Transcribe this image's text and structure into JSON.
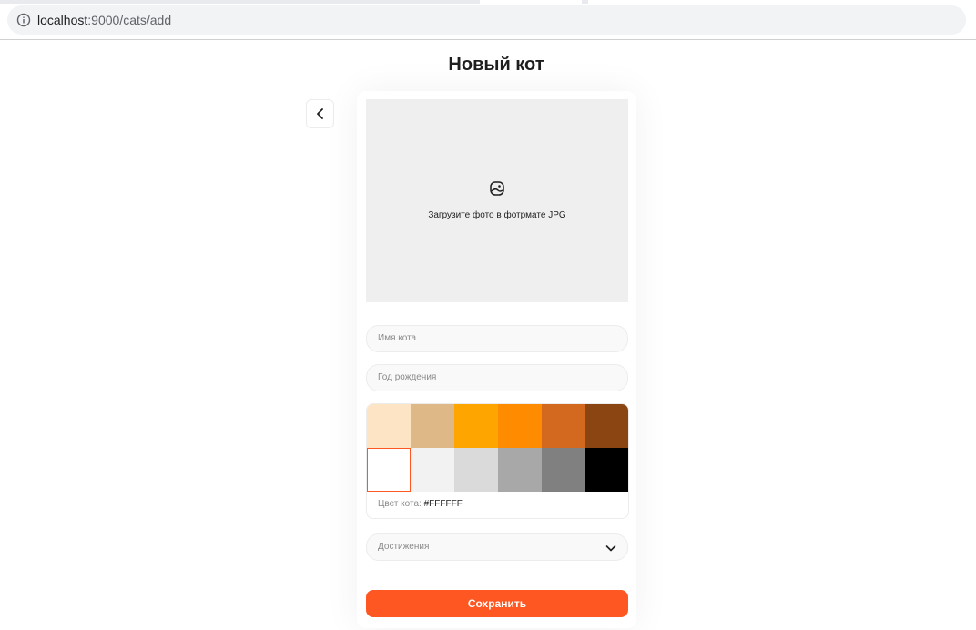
{
  "browser": {
    "url_host": "localhost",
    "url_path": ":9000/cats/add"
  },
  "page": {
    "title": "Новый кот"
  },
  "upload": {
    "text": "Загрузите фото в фотрмате JPG"
  },
  "form": {
    "name_placeholder": "Имя кота",
    "year_placeholder": "Год рождения",
    "color_label": "Цвет кота:",
    "color_value": "#FFFFFF",
    "achievements_label": "Достижения",
    "save_label": "Сохранить"
  },
  "palette": [
    [
      "#FDE4C4",
      "#DEB887",
      "#FFA500",
      "#FF8C00",
      "#D2691E",
      "#8B4513"
    ],
    [
      "#FFFFFF",
      "#F2F2F2",
      "#DADADA",
      "#A8A8A8",
      "#808080",
      "#000000"
    ]
  ],
  "selected_color": "#FFFFFF",
  "accent_color": "#FF5722"
}
